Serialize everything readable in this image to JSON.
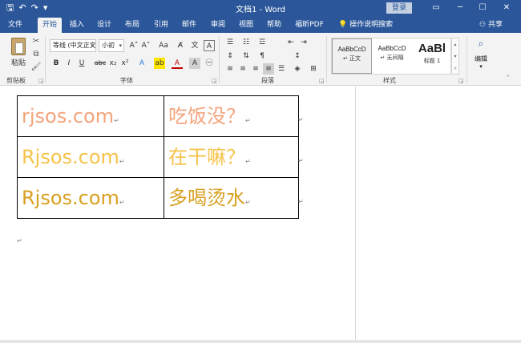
{
  "titlebar": {
    "title": "文档1 - Word",
    "login_label": "登录",
    "qat": {
      "save_glyph": "🖫",
      "undo_glyph": "↶",
      "redo_glyph": "↷",
      "customize_glyph": "▾"
    },
    "window_controls": {
      "restore_ribbon": "▭",
      "minimize": "─",
      "maximize": "☐",
      "close": "✕"
    }
  },
  "tabs": [
    {
      "label": "文件"
    },
    {
      "label": "开始",
      "active": true
    },
    {
      "label": "插入"
    },
    {
      "label": "设计"
    },
    {
      "label": "布局"
    },
    {
      "label": "引用"
    },
    {
      "label": "邮件"
    },
    {
      "label": "审阅"
    },
    {
      "label": "视图"
    },
    {
      "label": "帮助"
    },
    {
      "label": "福昕PDF"
    }
  ],
  "tell_me": {
    "icon_glyph": "💡",
    "label": "操作说明搜索"
  },
  "share": {
    "icon_glyph": "⚇",
    "label": "共享"
  },
  "ribbon": {
    "clipboard": {
      "paste_label": "粘贴",
      "group_label": "剪贴板",
      "cut_glyph": "✂",
      "copy_glyph": "⧉",
      "painter_glyph": "🖌"
    },
    "font": {
      "font_name": "等线 (中文正文)",
      "font_size": "小初",
      "grow": "A˄",
      "shrink": "A˅",
      "case": "Aa",
      "clear": "A̸",
      "phonetic": "文",
      "border_char": "A",
      "bold": "B",
      "italic": "I",
      "underline": "U",
      "strike": "abc",
      "subscript": "x₂",
      "superscript": "x²",
      "effects": "A",
      "highlight": "ab",
      "color": "A",
      "shading": "A",
      "circle": "㊀",
      "group_label": "字体"
    },
    "paragraph": {
      "group_label": "段落"
    },
    "styles": {
      "items": [
        {
          "sample": "AaBbCcD",
          "name": "↵ 正文"
        },
        {
          "sample": "AaBbCcD",
          "name": "↵ 无间隔"
        },
        {
          "sample": "AaBl",
          "name": "标题 1"
        }
      ],
      "group_label": "样式"
    },
    "editing": {
      "label": "编辑",
      "icon_glyph": "⌕"
    }
  },
  "document": {
    "rows": [
      {
        "left": "rjsos.com",
        "right": "吃饭没？",
        "color": "#f4a47c"
      },
      {
        "left": "Rjsos.com",
        "right": "在干嘛？",
        "color": "#f6c34a"
      },
      {
        "left": "Rjsos.com",
        "right": "多喝烫水",
        "color": "#d9a020"
      }
    ],
    "para_mark": "↵",
    "empty_para_mark": "↵"
  }
}
